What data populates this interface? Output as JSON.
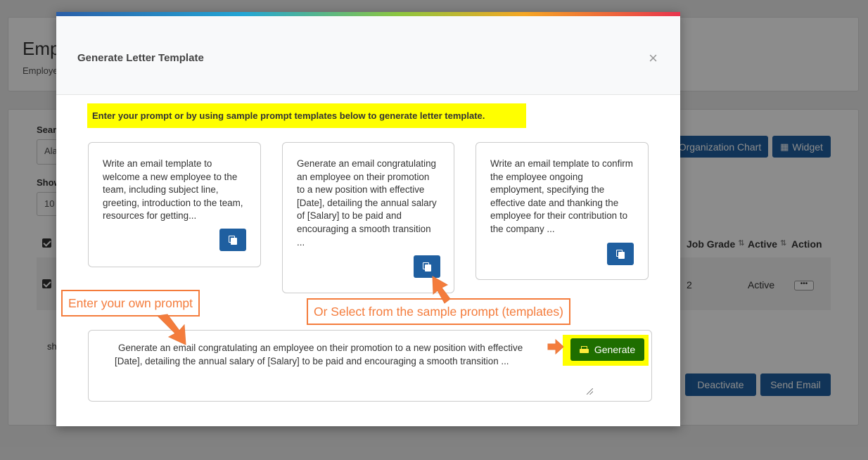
{
  "background": {
    "title": "Emp",
    "subtitle": "Employe",
    "search_label": "Sear",
    "search_value": "Ala",
    "show_label": "Show",
    "show_value": "10",
    "buttons": {
      "org_chart": "Organization Chart",
      "widget": "Widget",
      "deactivate": "Deactivate",
      "send_email": "Send Email"
    },
    "table": {
      "headers": {
        "job_grade": "Job Grade",
        "active": "Active",
        "action": "Action"
      },
      "row": {
        "job_grade": "2",
        "active": "Active",
        "action_dots": "•••"
      }
    },
    "footer_text": "sh"
  },
  "modal": {
    "title": "Generate Letter Template",
    "close_symbol": "×",
    "hint": "Enter your prompt or by using sample prompt templates below to generate letter template.",
    "templates": [
      {
        "text": "Write an email template to welcome a new employee to the team, including subject line, greeting, introduction to the team, resources for getting..."
      },
      {
        "text": "Generate an email congratulating an employee on their promotion to a new position with effective [Date], detailing the annual salary of [Salary] to be paid and encouraging a smooth transition ..."
      },
      {
        "text": "Write an email template to confirm the employee ongoing employment, specifying the effective date and thanking the employee for their contribution to the company ..."
      }
    ],
    "prompt_value": "Generate an email congratulating an employee on their promotion to a new position with effective [Date], detailing the annual salary of [Salary] to be paid and encouraging a smooth transition ...",
    "generate_label": "Generate"
  },
  "annotations": {
    "own_prompt": "Enter your own prompt",
    "select_sample": "Or Select from the sample prompt (templates)"
  },
  "colors": {
    "primary_button": "#1f5fa0",
    "generate_button": "#1e6e00",
    "highlight": "#ffff00",
    "annotation": "#f47c3c"
  }
}
